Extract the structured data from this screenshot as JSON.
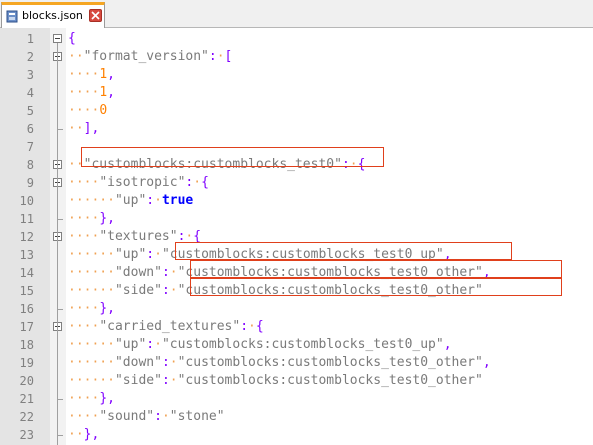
{
  "tab": {
    "label": "blocks.json",
    "icon": "file-icon",
    "close_icon": "close-icon",
    "accent_color": "#f5a623"
  },
  "editor": {
    "lines": [
      {
        "n": "1",
        "tokens": [
          [
            "op",
            "{"
          ]
        ],
        "fold": "open"
      },
      {
        "n": "2",
        "tokens": [
          [
            "ws",
            "··"
          ],
          [
            "str",
            "\"format_version\""
          ],
          [
            "op",
            ":"
          ],
          [
            "ws",
            "·"
          ],
          [
            "op",
            "["
          ]
        ],
        "fold": "open"
      },
      {
        "n": "3",
        "tokens": [
          [
            "ws",
            "····"
          ],
          [
            "num",
            "1"
          ],
          [
            "op",
            ","
          ]
        ]
      },
      {
        "n": "4",
        "tokens": [
          [
            "ws",
            "····"
          ],
          [
            "num",
            "1"
          ],
          [
            "op",
            ","
          ]
        ]
      },
      {
        "n": "5",
        "tokens": [
          [
            "ws",
            "····"
          ],
          [
            "num",
            "0"
          ]
        ]
      },
      {
        "n": "6",
        "tokens": [
          [
            "ws",
            "··"
          ],
          [
            "op",
            "],"
          ]
        ],
        "fold": "end"
      },
      {
        "n": "7",
        "tokens": []
      },
      {
        "n": "8",
        "tokens": [
          [
            "ws",
            "··"
          ],
          [
            "str",
            "\"customblocks:customblocks_test0\""
          ],
          [
            "op",
            ":"
          ],
          [
            "ws",
            "·"
          ],
          [
            "op",
            "{"
          ]
        ],
        "fold": "open"
      },
      {
        "n": "9",
        "tokens": [
          [
            "ws",
            "····"
          ],
          [
            "str",
            "\"isotropic\""
          ],
          [
            "op",
            ":"
          ],
          [
            "ws",
            "·"
          ],
          [
            "op",
            "{"
          ]
        ],
        "fold": "open"
      },
      {
        "n": "10",
        "tokens": [
          [
            "ws",
            "······"
          ],
          [
            "str",
            "\"up\""
          ],
          [
            "op",
            ":"
          ],
          [
            "ws",
            "·"
          ],
          [
            "kw",
            "true"
          ]
        ]
      },
      {
        "n": "11",
        "tokens": [
          [
            "ws",
            "····"
          ],
          [
            "op",
            "},"
          ]
        ],
        "fold": "end"
      },
      {
        "n": "12",
        "tokens": [
          [
            "ws",
            "····"
          ],
          [
            "str",
            "\"textures\""
          ],
          [
            "op",
            ":"
          ],
          [
            "ws",
            "·"
          ],
          [
            "op",
            "{"
          ]
        ],
        "fold": "open"
      },
      {
        "n": "13",
        "tokens": [
          [
            "ws",
            "······"
          ],
          [
            "str",
            "\"up\""
          ],
          [
            "op",
            ":"
          ],
          [
            "ws",
            "·"
          ],
          [
            "str",
            "\"customblocks:customblocks_test0_up\""
          ],
          [
            "op",
            ","
          ]
        ]
      },
      {
        "n": "14",
        "tokens": [
          [
            "ws",
            "······"
          ],
          [
            "str",
            "\"down\""
          ],
          [
            "op",
            ":"
          ],
          [
            "ws",
            "·"
          ],
          [
            "str",
            "\"customblocks:customblocks_test0_other\""
          ],
          [
            "op",
            ","
          ]
        ]
      },
      {
        "n": "15",
        "tokens": [
          [
            "ws",
            "······"
          ],
          [
            "str",
            "\"side\""
          ],
          [
            "op",
            ":"
          ],
          [
            "ws",
            "·"
          ],
          [
            "str",
            "\"customblocks:customblocks_test0_other\""
          ]
        ]
      },
      {
        "n": "16",
        "tokens": [
          [
            "ws",
            "····"
          ],
          [
            "op",
            "},"
          ]
        ],
        "fold": "end"
      },
      {
        "n": "17",
        "tokens": [
          [
            "ws",
            "····"
          ],
          [
            "str",
            "\"carried_textures\""
          ],
          [
            "op",
            ":"
          ],
          [
            "ws",
            "·"
          ],
          [
            "op",
            "{"
          ]
        ],
        "fold": "open"
      },
      {
        "n": "18",
        "tokens": [
          [
            "ws",
            "······"
          ],
          [
            "str",
            "\"up\""
          ],
          [
            "op",
            ":"
          ],
          [
            "ws",
            "·"
          ],
          [
            "str",
            "\"customblocks:customblocks_test0_up\""
          ],
          [
            "op",
            ","
          ]
        ]
      },
      {
        "n": "19",
        "tokens": [
          [
            "ws",
            "······"
          ],
          [
            "str",
            "\"down\""
          ],
          [
            "op",
            ":"
          ],
          [
            "ws",
            "·"
          ],
          [
            "str",
            "\"customblocks:customblocks_test0_other\""
          ],
          [
            "op",
            ","
          ]
        ]
      },
      {
        "n": "20",
        "tokens": [
          [
            "ws",
            "······"
          ],
          [
            "str",
            "\"side\""
          ],
          [
            "op",
            ":"
          ],
          [
            "ws",
            "·"
          ],
          [
            "str",
            "\"customblocks:customblocks_test0_other\""
          ]
        ]
      },
      {
        "n": "21",
        "tokens": [
          [
            "ws",
            "····"
          ],
          [
            "op",
            "},"
          ]
        ],
        "fold": "end"
      },
      {
        "n": "22",
        "tokens": [
          [
            "ws",
            "····"
          ],
          [
            "str",
            "\"sound\""
          ],
          [
            "op",
            ":"
          ],
          [
            "ws",
            "·"
          ],
          [
            "str",
            "\"stone\""
          ]
        ]
      },
      {
        "n": "23",
        "tokens": [
          [
            "ws",
            "··"
          ],
          [
            "op",
            "},"
          ]
        ],
        "fold": "end"
      }
    ]
  },
  "highlight_color": "#e0401c"
}
